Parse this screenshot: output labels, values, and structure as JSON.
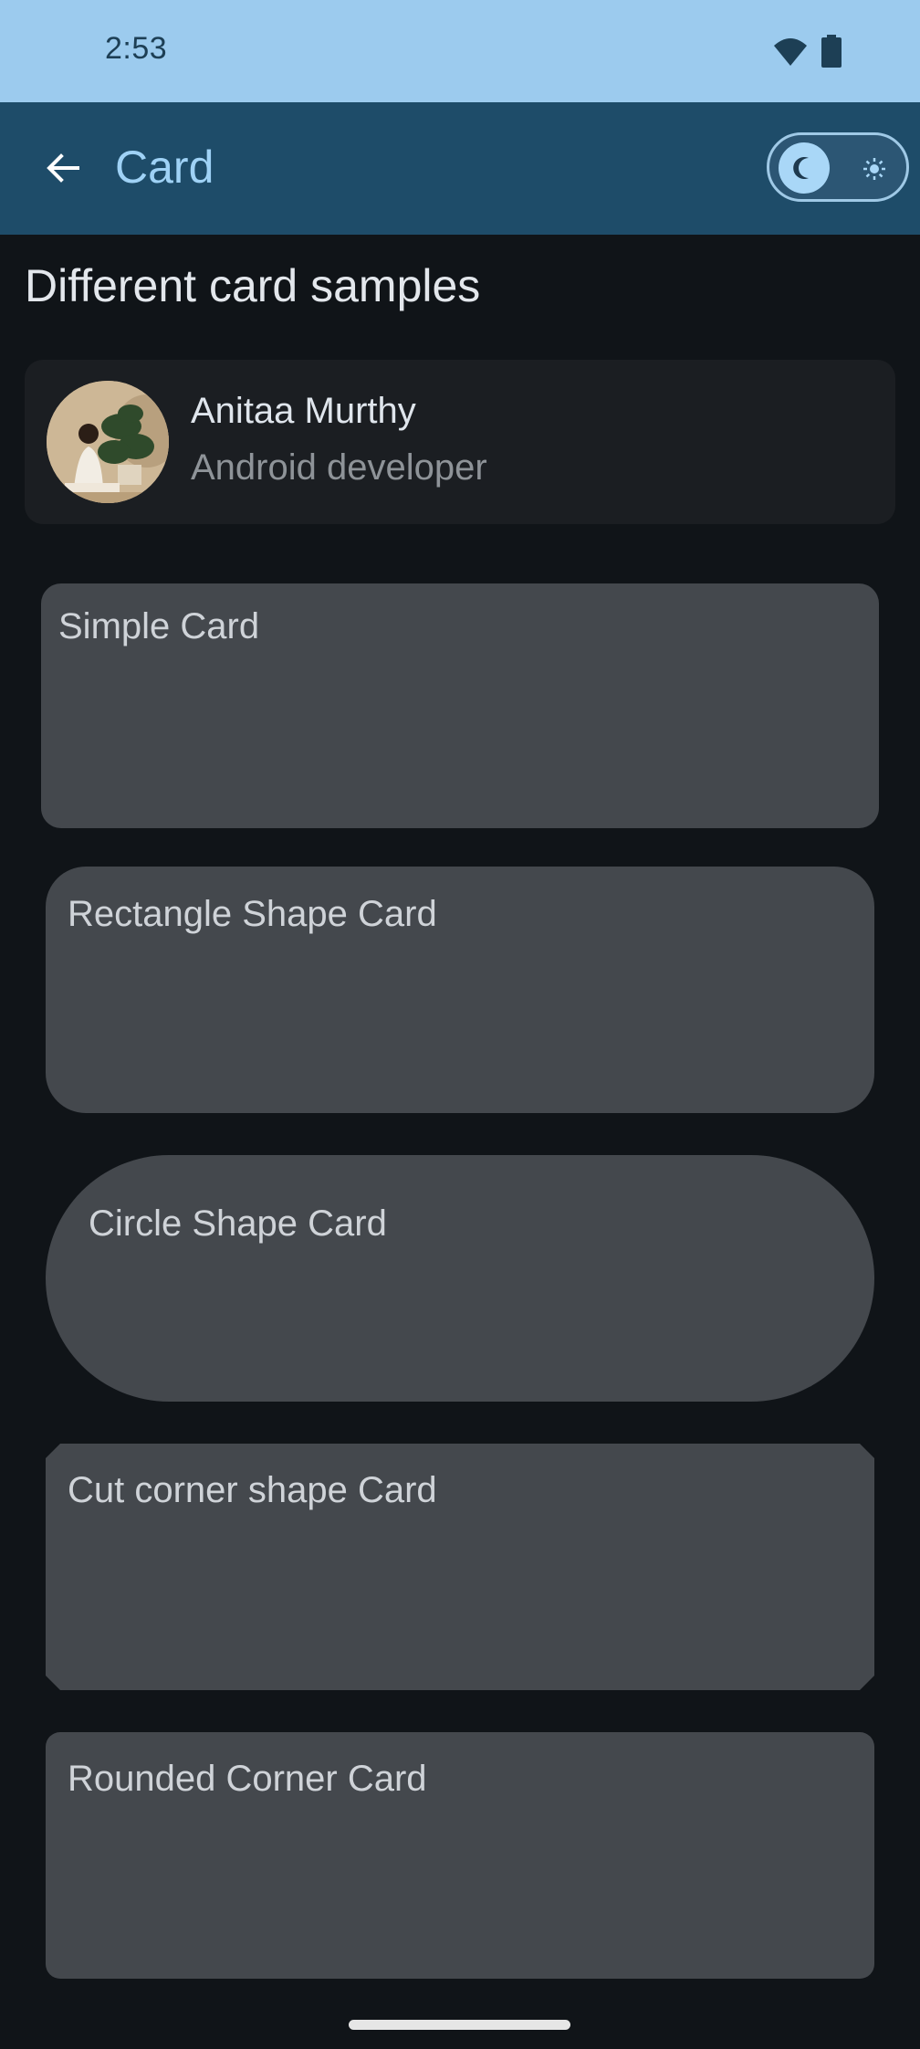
{
  "status_bar": {
    "time": "2:53",
    "icons": [
      "wifi-icon",
      "battery-icon"
    ]
  },
  "app_bar": {
    "back_icon": "arrow-back-icon",
    "title": "Card",
    "theme_toggle": {
      "selected": "dark",
      "dark_icon": "moon-icon",
      "light_icon": "sun-icon"
    }
  },
  "section": {
    "title": "Different card samples"
  },
  "profile": {
    "name": "Anitaa Murthy",
    "role": "Android developer"
  },
  "cards": [
    {
      "label": "Simple Card"
    },
    {
      "label": "Rectangle Shape Card"
    },
    {
      "label": "Circle Shape Card"
    },
    {
      "label": "Cut corner shape Card"
    },
    {
      "label": "Rounded Corner Card"
    }
  ],
  "colors": {
    "status_bar": "#9ccbee",
    "app_bar": "#1e4c69",
    "accent": "#9fd2f6",
    "background": "#101418",
    "card": "#44484d"
  }
}
